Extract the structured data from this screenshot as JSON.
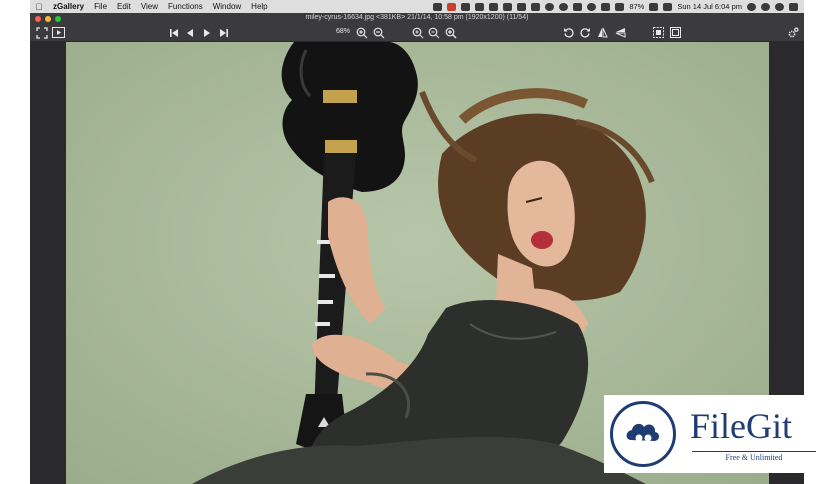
{
  "menubar": {
    "app_name": "zGallery",
    "menus": [
      "File",
      "Edit",
      "View",
      "Functions",
      "Window",
      "Help"
    ],
    "battery": "87%",
    "clock": "Sun 14 Jul  6:04 pm"
  },
  "window": {
    "title": "miley-cyrus-16634.jpg <381KB> 21/1/14, 10:58 pm (1920x1200) (11/54)"
  },
  "toolbar": {
    "zoom_level": "68%"
  },
  "watermark": {
    "name": "FileGit",
    "tagline": "Free & Unlimited"
  },
  "colors": {
    "accent": "#1f3d73",
    "background": "#a9b99b",
    "window_chrome": "#3b3b3d"
  }
}
